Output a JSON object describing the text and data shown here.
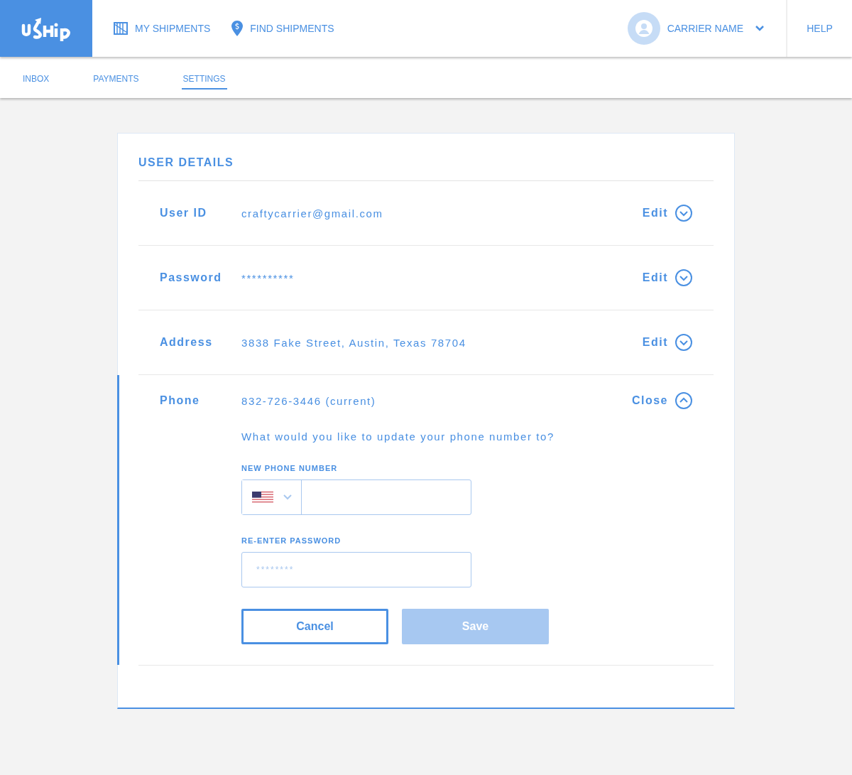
{
  "header": {
    "nav": [
      {
        "label": "MY SHIPMENTS",
        "kind": "crate"
      },
      {
        "label": "FIND SHIPMENTS",
        "kind": "pin"
      }
    ],
    "user": {
      "name": "CARRIER NAME"
    },
    "help": "HELP"
  },
  "subnav": [
    {
      "label": "INBOX",
      "selected": false
    },
    {
      "label": "PAYMENTS",
      "selected": false
    },
    {
      "label": "SETTINGS",
      "selected": true
    }
  ],
  "section": {
    "title": "USER DETAILS",
    "rows": [
      {
        "label": "User ID",
        "value": "craftycarrier@gmail.com",
        "action": "Edit",
        "expanded": false
      },
      {
        "label": "Password",
        "value": "**********",
        "action": "Edit",
        "expanded": false
      },
      {
        "label": "Address",
        "value": "3838 Fake Street, Austin, Texas 78704",
        "action": "Edit",
        "expanded": false
      },
      {
        "label": "Phone",
        "value": "832-726-3446 (current)",
        "action": "Close",
        "expanded": true,
        "prompt": "What would you like to update your phone number to?",
        "fields": [
          {
            "label": "NEW PHONE NUMBER",
            "kind": "phone"
          },
          {
            "label": "RE-ENTER PASSWORD",
            "kind": "password",
            "placeholder": "********"
          }
        ],
        "buttons": [
          {
            "label": "Cancel",
            "kind": "secondary",
            "disabled": false
          },
          {
            "label": "Save",
            "kind": "primary",
            "disabled": true
          }
        ]
      }
    ]
  }
}
